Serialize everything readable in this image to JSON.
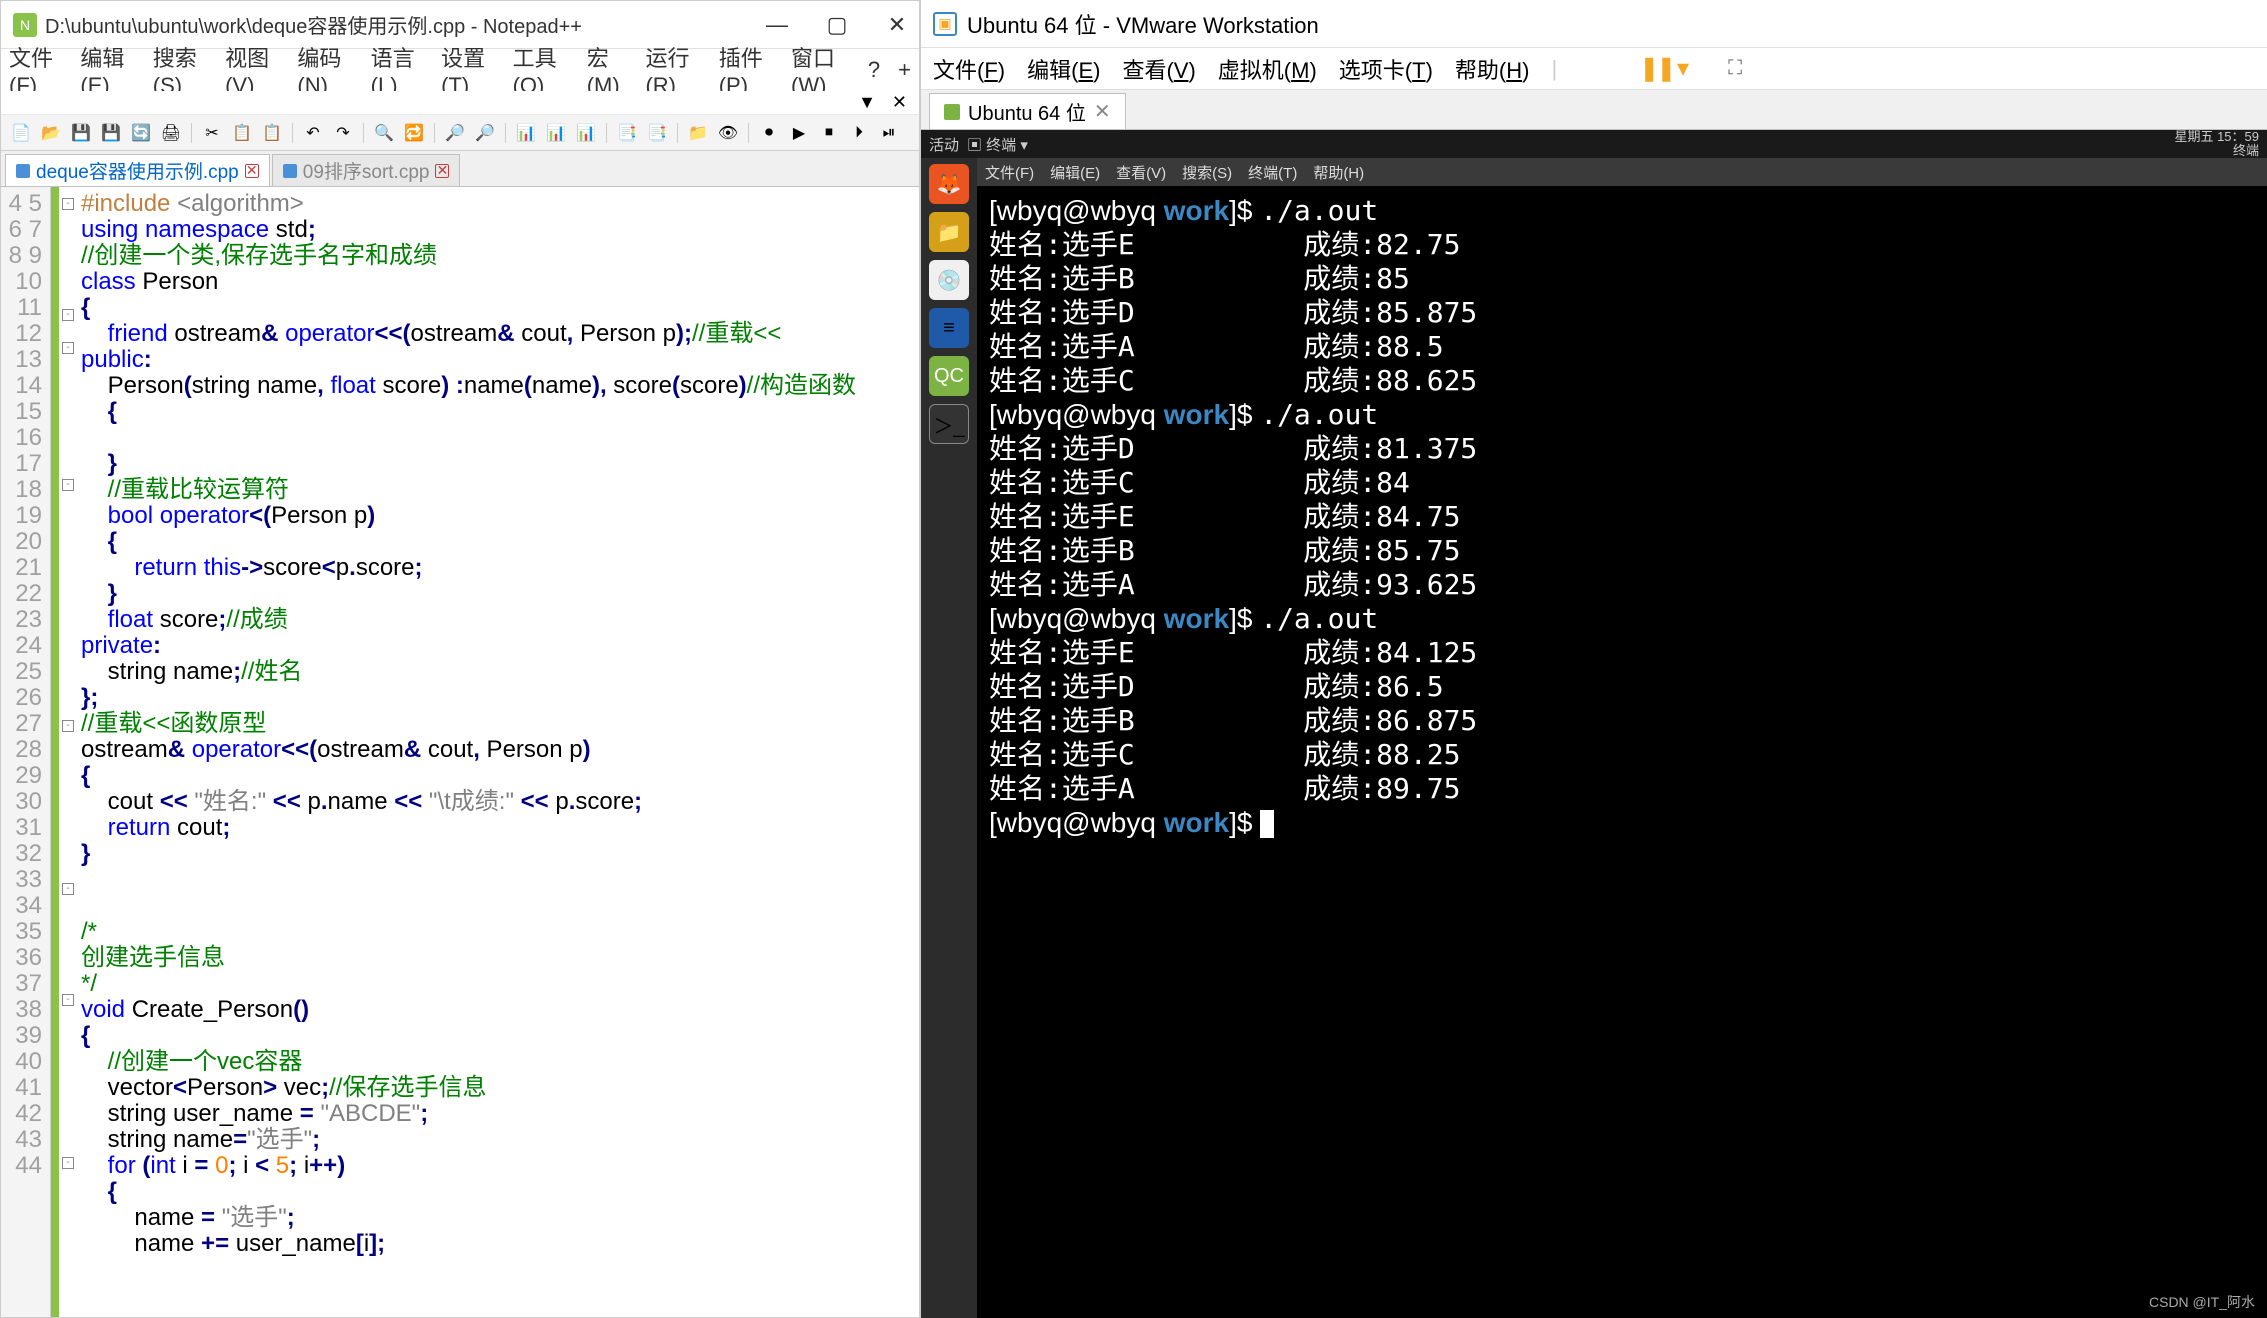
{
  "npp": {
    "title": "D:\\ubuntu\\ubuntu\\work\\deque容器使用示例.cpp - Notepad++",
    "menu": [
      "文件(F)",
      "编辑(E)",
      "搜索(S)",
      "视图(V)",
      "编码(N)",
      "语言(L)",
      "设置(T)",
      "工具(O)",
      "宏(M)",
      "运行(R)",
      "插件(P)",
      "窗口(W)",
      "?",
      "+"
    ],
    "tabs": [
      {
        "label": "deque容器使用示例.cpp",
        "active": true
      },
      {
        "label": "09排序sort.cpp",
        "active": false
      }
    ],
    "lines_start": 4,
    "lines_end": 44
  },
  "vm": {
    "title": "Ubuntu 64 位 - VMware Workstation",
    "menu": [
      "文件(F)",
      "编辑(E)",
      "查看(V)",
      "虚拟机(M)",
      "选项卡(T)",
      "帮助(H)"
    ],
    "tab": "Ubuntu 64 位",
    "ubuntu_top_left": [
      "活动",
      "▣ 终端 ▾"
    ],
    "ubuntu_top_right": [
      "星期五 15：59",
      "终端"
    ],
    "ubuntu_menu": [
      "文件(F)",
      "编辑(E)",
      "查看(V)",
      "搜索(S)",
      "终端(T)",
      "帮助(H)"
    ],
    "term": {
      "prompt_user": "[wbyq@wbyq ",
      "prompt_work": "work",
      "prompt_tail": "]$ ",
      "cmd": "./a.out",
      "runs": [
        [
          [
            "姓名:选手E",
            "成绩:82.75"
          ],
          [
            "姓名:选手B",
            "成绩:85"
          ],
          [
            "姓名:选手D",
            "成绩:85.875"
          ],
          [
            "姓名:选手A",
            "成绩:88.5"
          ],
          [
            "姓名:选手C",
            "成绩:88.625"
          ]
        ],
        [
          [
            "姓名:选手D",
            "成绩:81.375"
          ],
          [
            "姓名:选手C",
            "成绩:84"
          ],
          [
            "姓名:选手E",
            "成绩:84.75"
          ],
          [
            "姓名:选手B",
            "成绩:85.75"
          ],
          [
            "姓名:选手A",
            "成绩:93.625"
          ]
        ],
        [
          [
            "姓名:选手E",
            "成绩:84.125"
          ],
          [
            "姓名:选手D",
            "成绩:86.5"
          ],
          [
            "姓名:选手B",
            "成绩:86.875"
          ],
          [
            "姓名:选手C",
            "成绩:88.25"
          ],
          [
            "姓名:选手A",
            "成绩:89.75"
          ]
        ]
      ]
    }
  },
  "watermark": "CSDN @IT_阿水"
}
